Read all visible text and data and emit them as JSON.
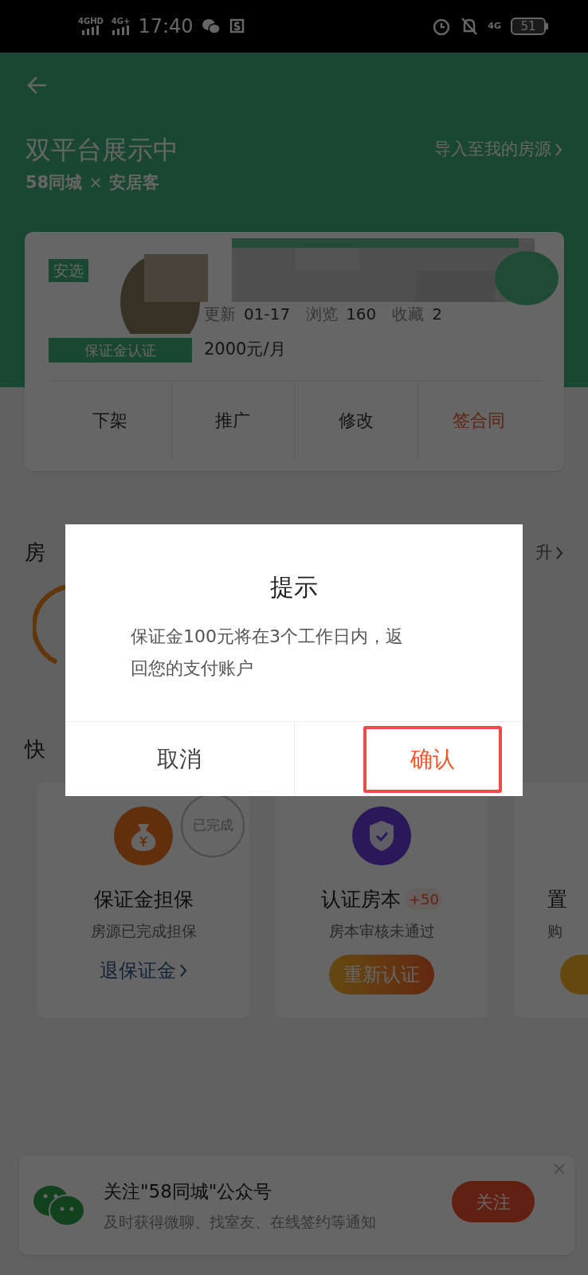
{
  "status_bar": {
    "time": "17:40",
    "signal_1": "4GHD",
    "signal_2": "4G+",
    "network": "4G",
    "battery": "51"
  },
  "header": {
    "title": "双平台展示中",
    "import_link": "导入至我的房源",
    "brand_a": "58同城",
    "brand_sep": "×",
    "brand_b": "安居客"
  },
  "listing": {
    "badge": "安选",
    "deposit_tag": "保证金认证",
    "stats": [
      {
        "label": "更新",
        "value": "01-17"
      },
      {
        "label": "浏览",
        "value": "160"
      },
      {
        "label": "收藏",
        "value": "2"
      }
    ],
    "price": "2000元/月",
    "actions": [
      {
        "label": "下架",
        "kind": "normal"
      },
      {
        "label": "推广",
        "kind": "normal"
      },
      {
        "label": "修改",
        "kind": "normal"
      },
      {
        "label": "签合同",
        "kind": "accent"
      }
    ]
  },
  "quality": {
    "title": "房",
    "link": "升"
  },
  "quick": {
    "title": "快"
  },
  "services": [
    {
      "title": "保证金担保",
      "subtitle": "房源已完成担保",
      "action": "退保证金",
      "kind": "link",
      "stamp": "已完成"
    },
    {
      "title": "认证房本",
      "bonus": "+50",
      "subtitle": "房本审核未通过",
      "action": "重新认证",
      "kind": "button"
    },
    {
      "title": "置",
      "subtitle": "购",
      "kind": "partial"
    }
  ],
  "banner": {
    "title": "关注\"58同城\"公众号",
    "subtitle": "及时获得微聊、找室友、在线签约等通知",
    "button": "关注"
  },
  "dialog": {
    "title": "提示",
    "message": "保证金100元将在3个工作日内，返回您的支付账户",
    "buttons": [
      {
        "label": "取消",
        "kind": "cancel",
        "highlighted": false
      },
      {
        "label": "确认",
        "kind": "confirm",
        "highlighted": true
      }
    ]
  }
}
